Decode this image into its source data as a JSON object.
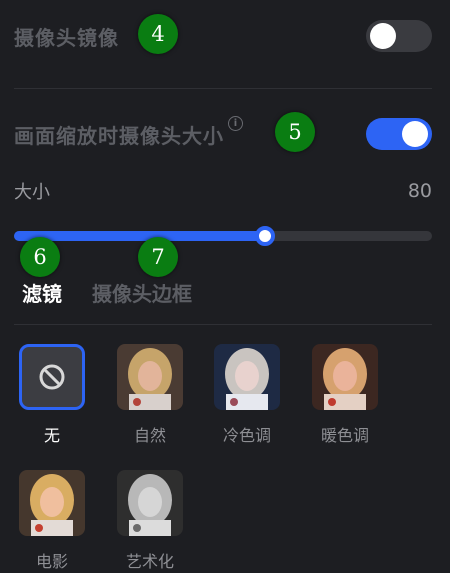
{
  "settings": {
    "camera_mirror": {
      "label": "摄像头镜像",
      "enabled": false
    },
    "zoom_camera_size": {
      "label": "画面缩放时摄像头大小",
      "enabled": true,
      "info_icon": "info-icon"
    },
    "size": {
      "label": "大小",
      "value": "80",
      "level_fraction": 0.6
    }
  },
  "tabs": [
    {
      "label": "滤镜",
      "active": true
    },
    {
      "label": "摄像头边框",
      "active": false
    }
  ],
  "filters": [
    {
      "label": "无",
      "selected": true,
      "icon": "ban-icon"
    },
    {
      "label": "自然",
      "selected": false,
      "tone": "natural"
    },
    {
      "label": "冷色调",
      "selected": false,
      "tone": "cool"
    },
    {
      "label": "暖色调",
      "selected": false,
      "tone": "warm"
    },
    {
      "label": "电影",
      "selected": false,
      "tone": "film"
    },
    {
      "label": "艺术化",
      "selected": false,
      "tone": "mono"
    }
  ],
  "markers": [
    "4",
    "5",
    "6",
    "7"
  ],
  "colors": {
    "accent": "#2d64f4",
    "marker": "#0a7d12",
    "background": "#1d1e22"
  }
}
